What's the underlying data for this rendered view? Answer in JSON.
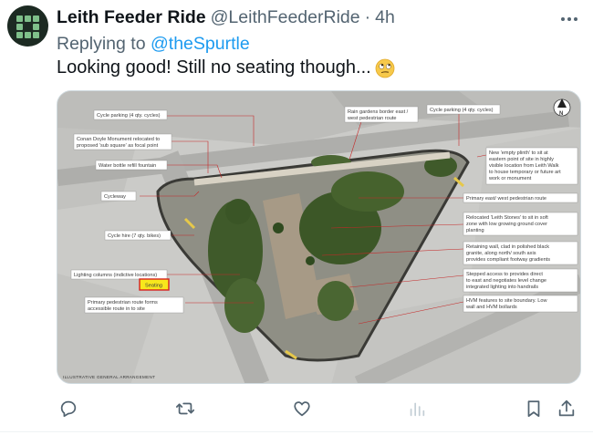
{
  "tweet": {
    "author_name": "Leith Feeder Ride",
    "author_handle": "@LeithFeederRide",
    "separator": "·",
    "time": "4h",
    "replying_to_prefix": "Replying to",
    "replying_to_handle": "@theSpurtle",
    "text": "Looking good! Still no seating though...",
    "emoji": "face-with-rolling-eyes"
  },
  "media": {
    "labels": {
      "cycle_parking_left": "Cycle parking (4 qty. cycles)",
      "conan_doyle_1": "Conan Doyle Monument relocated to",
      "conan_doyle_2": "proposed 'sub square' as focal point",
      "water_bottle": "Water bottle refill fountain",
      "cycleway": "Cycleway",
      "cycle_hire": "Cycle hire (7 qty. bikes)",
      "lighting_columns": "Lighting columns (indictive locations)",
      "seating": "Seating",
      "primary_route_1": "Primary pedestrian route  forms",
      "primary_route_2": "accessible route in to site",
      "rain_gardens_1": "Rain gardens border east /",
      "rain_gardens_2": "west pedestrian route",
      "cycle_parking_right": "Cycle parking (4 qty. cycles)",
      "north": "N",
      "plinth_1": "New 'empty plinth' to sit at",
      "plinth_2": "eastern point of site in highly",
      "plinth_3": "visible location from Leith Walk",
      "plinth_4": "to house temporary or future art",
      "plinth_5": "work or monument",
      "primary_ew": "Primary east/ west pedestrian route",
      "leith_stones_1": "Relocated 'Leith Stones' to sit in soft",
      "leith_stones_2": "zone with low growing ground cover",
      "leith_stones_3": "planting",
      "retaining_1": "Retaining wall, clad in polished black",
      "retaining_2": "granite, along north/ south axis",
      "retaining_3": "provides compliant footway gradients",
      "stepped_1": "Stepped access to provides direct",
      "stepped_2": "to east and negotiates level change",
      "stepped_3": "integrated lighting into handrails",
      "hvm_1": "HVM features to site boundary. Low",
      "hvm_2": "wall and HVM bollards",
      "caption": "ILLUSTRATIVE GENERAL ARRANGEMENT"
    }
  },
  "actions": [
    "reply-icon",
    "retweet-icon",
    "like-icon",
    "views-icon",
    "bookmark-icon",
    "share-icon"
  ]
}
